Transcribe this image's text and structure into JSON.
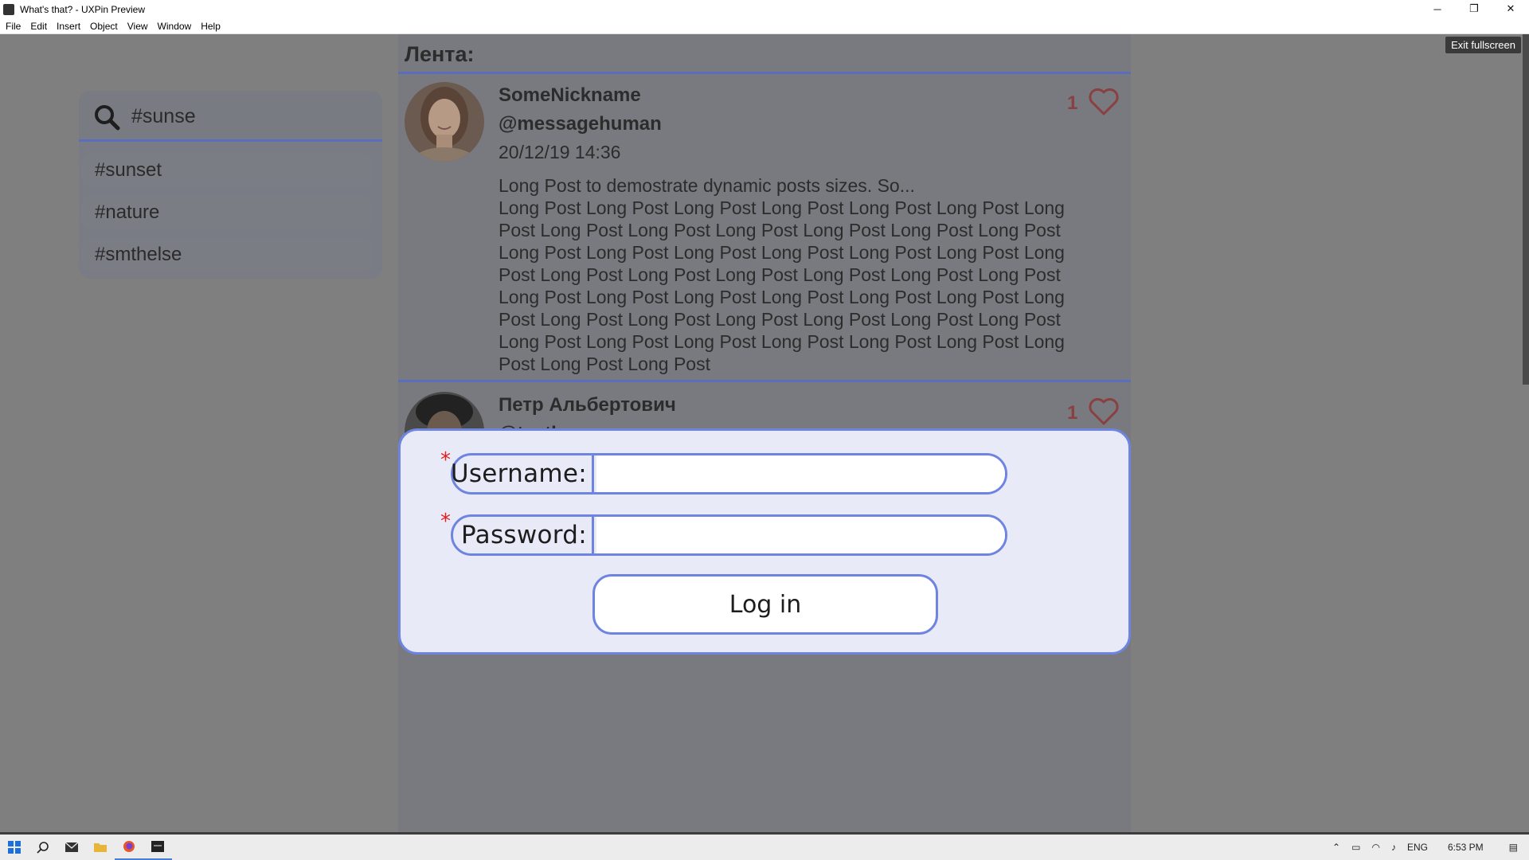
{
  "window": {
    "title": "What's that? - UXPin Preview",
    "controls": {
      "minimize": "─",
      "restore": "❐",
      "close": "✕"
    }
  },
  "menu": [
    "File",
    "Edit",
    "Insert",
    "Object",
    "View",
    "Window",
    "Help"
  ],
  "viewer": {
    "exit_fullscreen": "Exit fullscreen"
  },
  "search": {
    "query": "#sunse",
    "suggestions": [
      "#sunset",
      "#nature",
      "#smthelse"
    ]
  },
  "feed": {
    "title": "Лента:",
    "posts": [
      {
        "name": "SomeNickname",
        "handle": "@messagehuman",
        "date": "20/12/19 14:36",
        "intro": "Long Post to demostrate dynamic posts sizes. So...",
        "body": "Long Post Long Post Long Post Long Post Long Post Long Post Long Post Long Post Long Post Long Post Long Post Long Post Long Post Long Post Long Post Long Post Long Post Long Post Long Post Long Post Long Post Long Post Long Post Long Post Long Post Long Post Long Post Long Post Long Post Long Post Long Post Long Post Long Post Long Post Long Post Long Post Long Post Long Post Long Post Long Post Long Post Long Post Long Post Long Post Long Post Long Post Long Post Long Post",
        "likes": "1"
      },
      {
        "name": "Петр Альбертович",
        "handle": "@testhuman",
        "likes": "1"
      }
    ]
  },
  "login": {
    "required_mark": "*",
    "username_label": "Username:",
    "password_label": "Password:",
    "username_value": "",
    "password_value": "",
    "submit_label": "Log in"
  },
  "taskbar": {
    "language": "ENG",
    "time": "6:53 PM"
  },
  "colors": {
    "accent": "#6f84e0",
    "overlay": "#7f7f7f",
    "modal_bg": "#e8ebf7",
    "required": "#e02020",
    "like": "#8a4040"
  }
}
